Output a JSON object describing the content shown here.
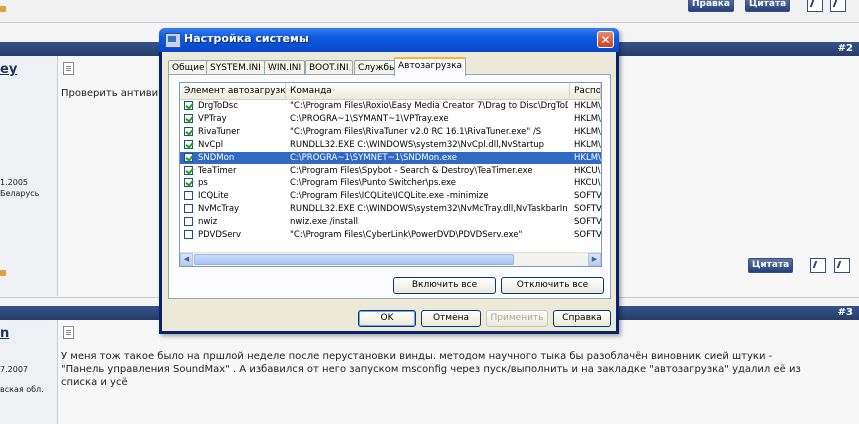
{
  "forum": {
    "top_buttons": {
      "pravka": "Правка",
      "citata": "Цитата"
    },
    "post2": {
      "number": "#2",
      "username_fragment": "ey",
      "text": "Проверить антиви",
      "date_fragment": "1.2005",
      "location_fragment": "Беларусь",
      "citata": "Цитата"
    },
    "post3": {
      "number": "#3",
      "username_fragment": "n",
      "date_fragment": "7.2007",
      "location_fragment": "вская обл.",
      "text_line1": "У меня тож такое было на пршлой неделе после перустановки винды. методом научного тыка бы разоблачён виновник сией штуки -",
      "text_line2": "\"Панель управления SoundMax\" . А избавился от него запуском msconfig через пуск/выполнить и на закладке \"автозагрузка\" удалил её из",
      "text_line3": "списка и усё"
    }
  },
  "dialog": {
    "title": "Настройка системы",
    "close_glyph": "✕",
    "tabs": [
      "Общие",
      "SYSTEM.INI",
      "WIN.INI",
      "BOOT.INI",
      "Службы",
      "Автозагрузка"
    ],
    "active_tab": "Автозагрузка",
    "columns": [
      "Элемент автозагрузки",
      "Команда",
      "Распо"
    ],
    "rows": [
      {
        "name": "DrgToDsc",
        "command": "\"C:\\Program Files\\Roxio\\Easy Media Creator 7\\Drag to Disc\\DrgToDsc...",
        "location": "HKLM\\",
        "checked": true
      },
      {
        "name": "VPTray",
        "command": "C:\\PROGRA~1\\SYMANT~1\\VPTray.exe",
        "location": "HKLM\\",
        "checked": true
      },
      {
        "name": "RivaTuner",
        "command": "\"C:\\Program Files\\RivaTuner v2.0 RC 16.1\\RivaTuner.exe\" /S",
        "location": "HKLM\\",
        "checked": true
      },
      {
        "name": "NvCpl",
        "command": "RUNDLL32.EXE C:\\WINDOWS\\system32\\NvCpl.dll,NvStartup",
        "location": "HKLM\\",
        "checked": true
      },
      {
        "name": "SNDMon",
        "command": "C:\\PROGRA~1\\SYMNET~1\\SNDMon.exe",
        "location": "HKLM\\",
        "checked": true,
        "selected": true
      },
      {
        "name": "TeaTimer",
        "command": "C:\\Program Files\\Spybot - Search & Destroy\\TeaTimer.exe",
        "location": "HKCU\\",
        "checked": true
      },
      {
        "name": "ps",
        "command": "C:\\Program Files\\Punto Switcher\\ps.exe",
        "location": "HKCU\\",
        "checked": true
      },
      {
        "name": "ICQLite",
        "command": "C:\\Program Files\\ICQLite\\ICQLite.exe -minimize",
        "location": "SOFTV",
        "checked": false
      },
      {
        "name": "NvMcTray",
        "command": "RUNDLL32.EXE C:\\WINDOWS\\system32\\NvMcTray.dll,NvTaskbarInit",
        "location": "SOFTV",
        "checked": false
      },
      {
        "name": "nwiz",
        "command": "nwiz.exe /install",
        "location": "SOFTV",
        "checked": false
      },
      {
        "name": "PDVDServ",
        "command": "\"C:\\Program Files\\CyberLink\\PowerDVD\\PDVDServ.exe\"",
        "location": "SOFTV",
        "checked": false
      }
    ],
    "enable_all": "Включить все",
    "disable_all": "Отключить все",
    "ok": "OK",
    "cancel": "Отмена",
    "apply": "Применить",
    "help": "Справка"
  }
}
